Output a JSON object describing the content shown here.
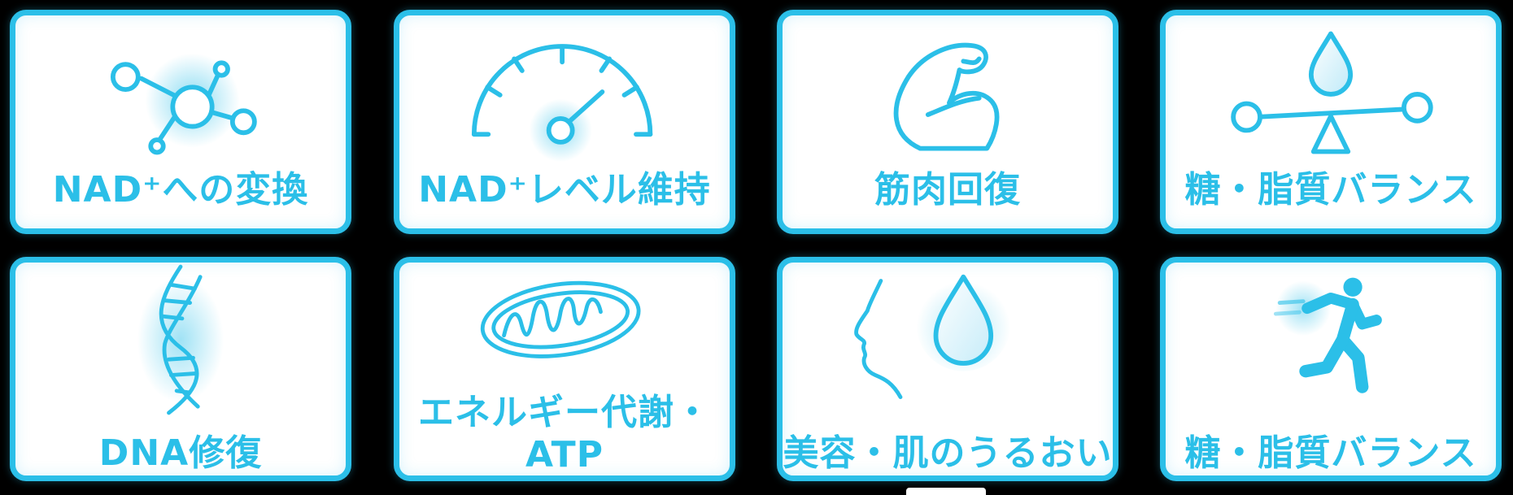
{
  "colors": {
    "accent": "#2bbfe8",
    "card_background": "#ffffff",
    "page_background": "#000000"
  },
  "cards": [
    {
      "icon": "molecule-icon",
      "label": "NAD⁺への変換"
    },
    {
      "icon": "gauge-icon",
      "label": "NAD⁺レベル維持"
    },
    {
      "icon": "muscle-arm-icon",
      "label": "筋肉回復"
    },
    {
      "icon": "balance-scale-icon",
      "label": "糖・脂質バランス"
    },
    {
      "icon": "dna-icon",
      "label": "DNA修復"
    },
    {
      "icon": "mitochondria-icon",
      "label_line1": "エネルギー代謝・",
      "label_line2": "ATP"
    },
    {
      "icon": "face-droplet-icon",
      "label": "美容・肌のうるおい"
    },
    {
      "icon": "running-person-icon",
      "label": "糖・脂質バランス"
    }
  ]
}
